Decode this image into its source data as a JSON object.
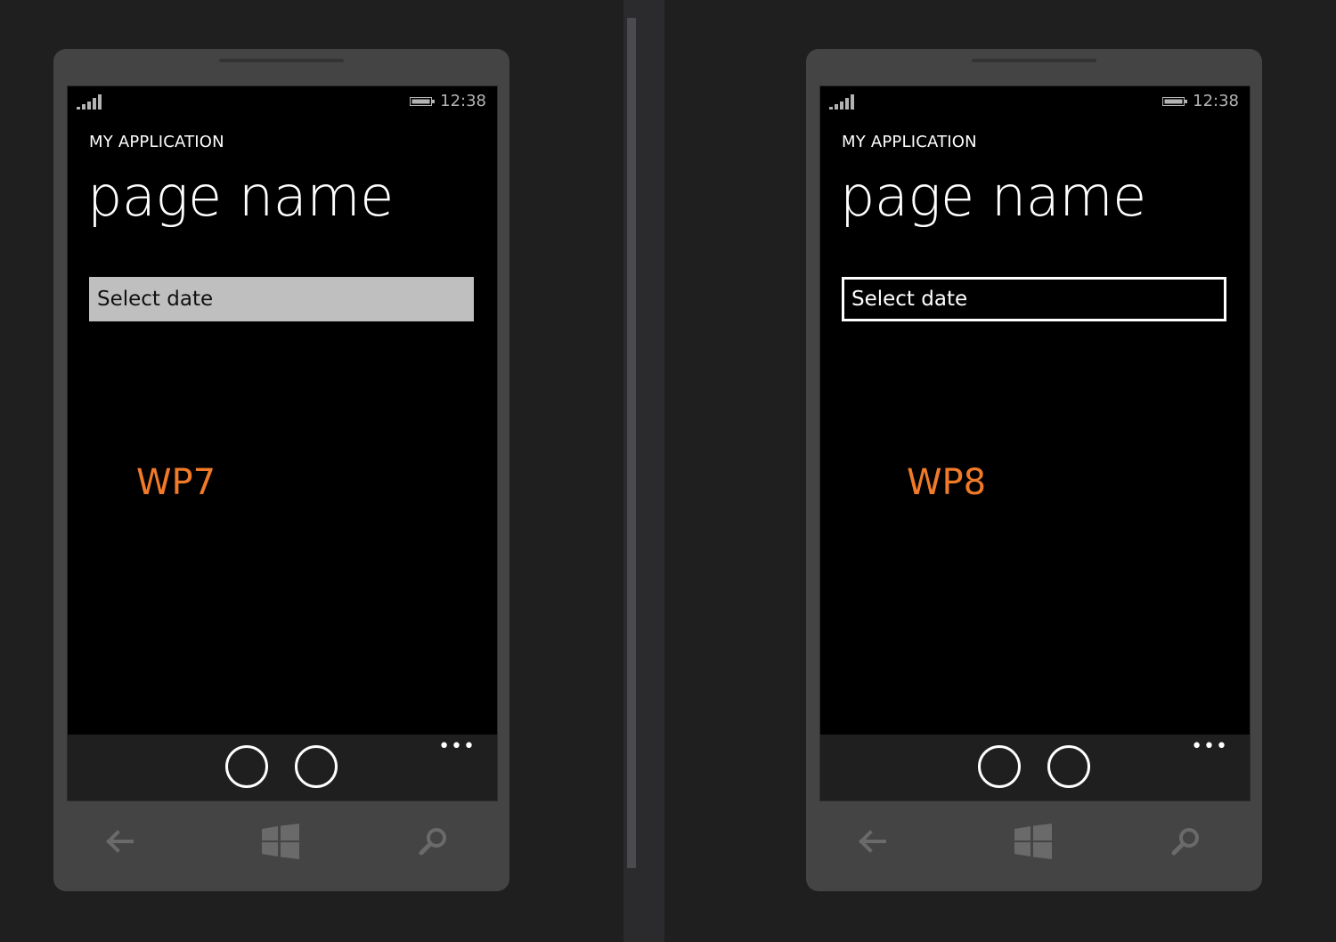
{
  "phones": [
    {
      "status": {
        "time": "12:38"
      },
      "app_title": "MY APPLICATION",
      "page_title": "page name",
      "date_field": "Select date",
      "version_label": "WP7",
      "appbar": {
        "more": "•••"
      }
    },
    {
      "status": {
        "time": "12:38"
      },
      "app_title": "MY APPLICATION",
      "page_title": "page name",
      "date_field": "Select date",
      "version_label": "WP8",
      "appbar": {
        "more": "•••"
      }
    }
  ],
  "colors": {
    "accent_orange": "#f07a28",
    "phone_body": "#444444",
    "screen": "#000000",
    "wp7_field": "#bfbfbf"
  }
}
